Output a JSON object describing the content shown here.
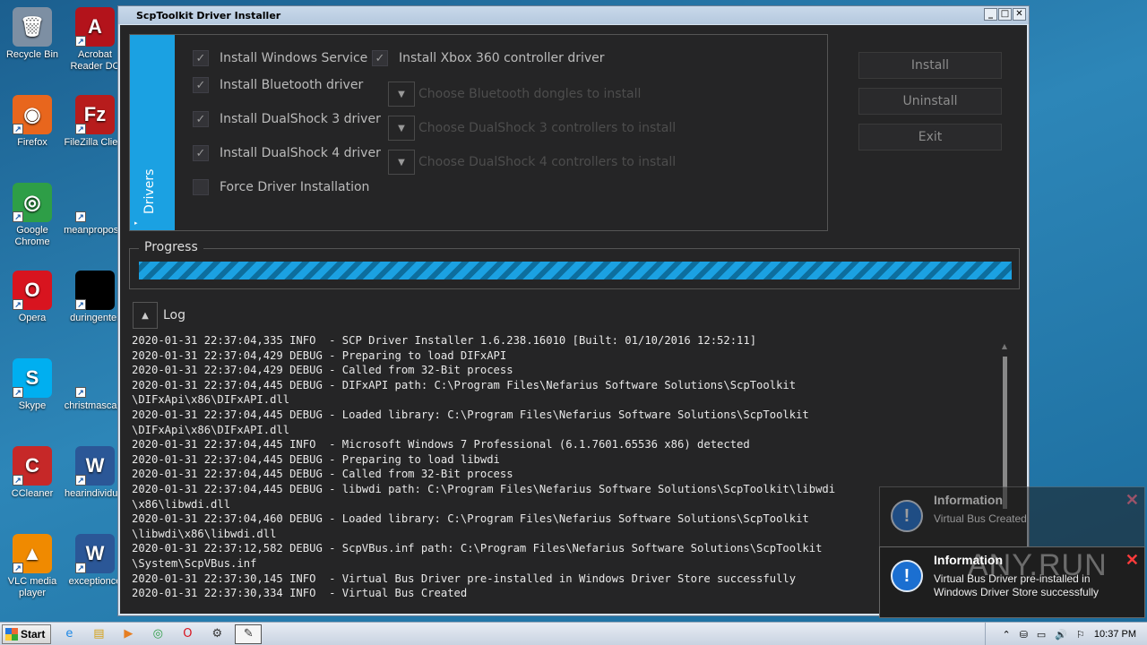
{
  "window": {
    "title": "ScpToolkit Driver Installer",
    "minimize": "_",
    "maximize": "□",
    "close": "✕"
  },
  "drivers": {
    "tab_label": "Drivers",
    "tab_arrow": "▸",
    "check_mark": "✓",
    "install_windows_service": "Install Windows Service",
    "install_xbox360": "Install Xbox 360 controller driver",
    "install_bluetooth": "Install Bluetooth driver",
    "install_ds3": "Install DualShock 3 driver",
    "install_ds4": "Install DualShock 4 driver",
    "force_install": "Force Driver Installation",
    "combo_arrow": "▼",
    "choose_bluetooth": "Choose Bluetooth dongles to install",
    "choose_ds3": "Choose DualShock 3 controllers to install",
    "choose_ds4": "Choose DualShock 4 controllers to install"
  },
  "actions": {
    "install": "Install",
    "uninstall": "Uninstall",
    "exit": "Exit"
  },
  "progress": {
    "label": "Progress",
    "value": 100
  },
  "log": {
    "label": "Log",
    "toggle": "▲",
    "scroll_up": "▲",
    "lines": [
      "2020-01-31 22:37:04,335 INFO  - SCP Driver Installer 1.6.238.16010 [Built: 01/10/2016 12:52:11]",
      "2020-01-31 22:37:04,429 DEBUG - Preparing to load DIFxAPI",
      "2020-01-31 22:37:04,429 DEBUG - Called from 32-Bit process",
      "2020-01-31 22:37:04,445 DEBUG - DIFxAPI path: C:\\Program Files\\Nefarius Software Solutions\\ScpToolkit",
      "\\DIFxApi\\x86\\DIFxAPI.dll",
      "2020-01-31 22:37:04,445 DEBUG - Loaded library: C:\\Program Files\\Nefarius Software Solutions\\ScpToolkit",
      "\\DIFxApi\\x86\\DIFxAPI.dll",
      "2020-01-31 22:37:04,445 INFO  - Microsoft Windows 7 Professional (6.1.7601.65536 x86) detected",
      "2020-01-31 22:37:04,445 DEBUG - Preparing to load libwdi",
      "2020-01-31 22:37:04,445 DEBUG - Called from 32-Bit process",
      "2020-01-31 22:37:04,445 DEBUG - libwdi path: C:\\Program Files\\Nefarius Software Solutions\\ScpToolkit\\libwdi",
      "\\x86\\libwdi.dll",
      "2020-01-31 22:37:04,460 DEBUG - Loaded library: C:\\Program Files\\Nefarius Software Solutions\\ScpToolkit",
      "\\libwdi\\x86\\libwdi.dll",
      "2020-01-31 22:37:12,582 DEBUG - ScpVBus.inf path: C:\\Program Files\\Nefarius Software Solutions\\ScpToolkit",
      "\\System\\ScpVBus.inf",
      "2020-01-31 22:37:30,145 INFO  - Virtual Bus Driver pre-installed in Windows Driver Store successfully",
      "2020-01-31 22:37:30,334 INFO  - Virtual Bus Created"
    ]
  },
  "toasts": [
    {
      "title": "Information",
      "message": "Virtual Bus Created",
      "icon": "!",
      "close": "✕"
    },
    {
      "title": "Information",
      "message": "Virtual Bus Driver pre-installed in Windows Driver Store successfully",
      "icon": "!",
      "close": "✕"
    }
  ],
  "desktop": {
    "shortcut_arrow": "↗",
    "icons": [
      {
        "label": "Recycle Bin",
        "glyph": "🗑",
        "color": "#7d8fa3"
      },
      {
        "label": "Acrobat Reader DC",
        "glyph": "A",
        "color": "#b3131b"
      },
      {
        "label": "Firefox",
        "glyph": "◉",
        "color": "#e8661d"
      },
      {
        "label": "FileZilla Client",
        "glyph": "Fz",
        "color": "#b71c1c"
      },
      {
        "label": "Google Chrome",
        "glyph": "◎",
        "color": "#2e9e47"
      },
      {
        "label": "meanproposal",
        "glyph": "",
        "color": "transparent"
      },
      {
        "label": "Opera",
        "glyph": "O",
        "color": "#d8141f"
      },
      {
        "label": "duringenter",
        "glyph": "",
        "color": "#000000"
      },
      {
        "label": "Skype",
        "glyph": "S",
        "color": "#00aff0"
      },
      {
        "label": "christmascard",
        "glyph": "",
        "color": "transparent"
      },
      {
        "label": "CCleaner",
        "glyph": "C",
        "color": "#c62828"
      },
      {
        "label": "hearindividual",
        "glyph": "W",
        "color": "#2b5797"
      },
      {
        "label": "VLC media player",
        "glyph": "▲",
        "color": "#f08a00"
      },
      {
        "label": "exceptionce",
        "glyph": "W",
        "color": "#2b5797"
      }
    ]
  },
  "taskbar": {
    "start": "Start",
    "clock": "10:37 PM",
    "apps": [
      {
        "name": "ie-icon",
        "glyph": "e",
        "color": "#1e88e5"
      },
      {
        "name": "explorer-icon",
        "glyph": "▤",
        "color": "#d4a017"
      },
      {
        "name": "media-player-icon",
        "glyph": "▶",
        "color": "#e67e22"
      },
      {
        "name": "chrome-icon",
        "glyph": "◎",
        "color": "#2e9e47"
      },
      {
        "name": "opera-icon",
        "glyph": "O",
        "color": "#d8141f"
      },
      {
        "name": "scptoolkit-icon",
        "glyph": "⚙",
        "color": "#333333"
      },
      {
        "name": "installer-icon",
        "glyph": "✎",
        "color": "#333333"
      }
    ],
    "tray": [
      "⌃",
      "⛁",
      "▭",
      "🔊",
      "⚐"
    ]
  },
  "watermark": "ANY.RUN"
}
